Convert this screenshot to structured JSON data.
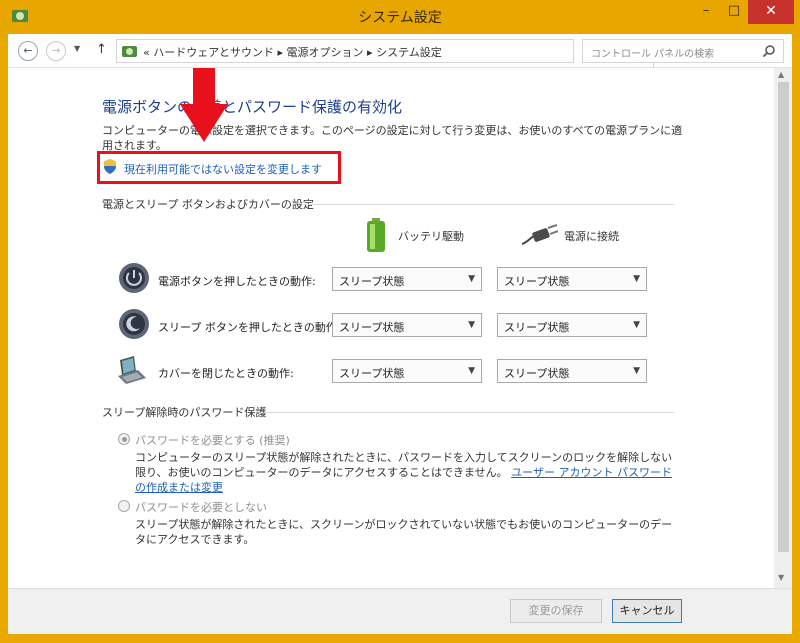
{
  "window": {
    "title": "システム設定",
    "minimize": "–",
    "maximize": "□",
    "close": "✕"
  },
  "address": {
    "prefix": "«",
    "crumbs": [
      "ハードウェアとサウンド",
      "電源オプション",
      "システム設定"
    ],
    "separator": "▸",
    "search_placeholder": "コントロール パネルの検索"
  },
  "page": {
    "heading": "電源ボタンの定義とパスワード保護の有効化",
    "description": "コンピューターの電源設定を選択できます。このページの設定に対して行う変更は、お使いのすべての電源プランに適用されます。",
    "change_link": "現在利用可能ではない設定を変更します"
  },
  "buttons_section": {
    "label": "電源とスリープ ボタンおよびカバーの設定",
    "col_battery": "バッテリ駆動",
    "col_plugged": "電源に接続",
    "rows": [
      {
        "label": "電源ボタンを押したときの動作:",
        "battery": "スリープ状態",
        "plugged": "スリープ状態",
        "icon": "power-button-icon"
      },
      {
        "label": "スリープ ボタンを押したときの動作:",
        "battery": "スリープ状態",
        "plugged": "スリープ状態",
        "icon": "sleep-button-icon"
      },
      {
        "label": "カバーを閉じたときの動作:",
        "battery": "スリープ状態",
        "plugged": "スリープ状態",
        "icon": "laptop-lid-icon"
      }
    ]
  },
  "password_section": {
    "label": "スリープ解除時のパスワード保護",
    "option1_label": "パスワードを必要とする (推奨)",
    "option1_desc": "コンピューターのスリープ状態が解除されたときに、パスワードを入力してスクリーンのロックを解除しない限り、お使いのコンピューターのデータにアクセスすることはできません。",
    "option1_link": "ユーザー アカウント パスワードの作成または変更",
    "option2_label": "パスワードを必要としない",
    "option2_desc": "スリープ状態が解除されたときに、スクリーンがロックされていない状態でもお使いのコンピューターのデータにアクセスできます。"
  },
  "footer": {
    "save": "変更の保存",
    "cancel": "キャンセル"
  },
  "colors": {
    "frame": "#e9a800",
    "link": "#1d5fba",
    "heading": "#1e3f8f",
    "highlight": "#e8101a"
  }
}
